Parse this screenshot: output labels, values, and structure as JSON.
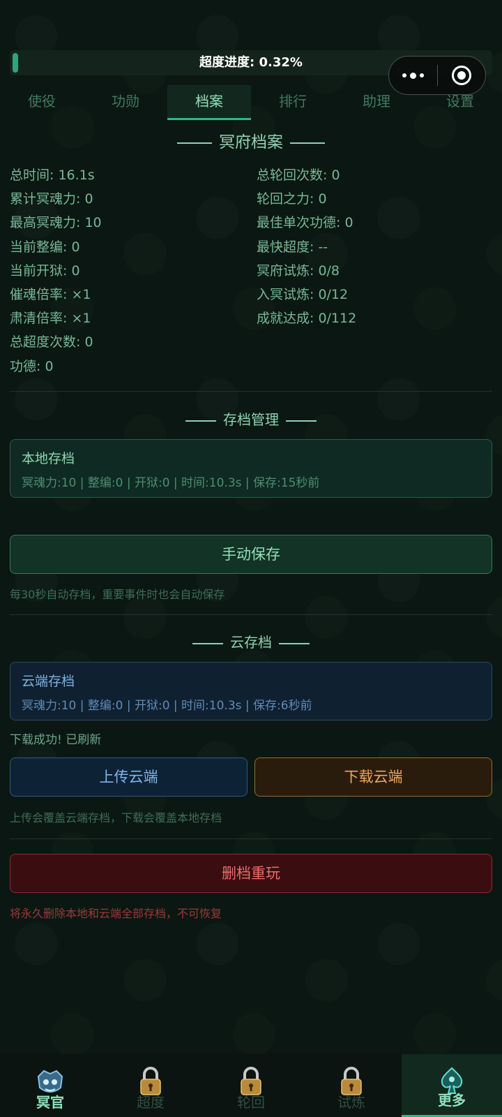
{
  "progress": {
    "label": "超度进度: 0.32%",
    "value": 0.32
  },
  "tabs": [
    "使役",
    "功勋",
    "档案",
    "排行",
    "助理",
    "设置"
  ],
  "active_tab": "档案",
  "archive": {
    "title": "冥府档案",
    "left_stats": [
      "总时间: 16.1s",
      "累计冥魂力: 0",
      "最高冥魂力: 10",
      "当前整编: 0",
      "当前开狱: 0",
      "催魂倍率: ×1",
      "肃清倍率: ×1",
      "总超度次数: 0",
      "功德: 0"
    ],
    "right_stats": [
      "总轮回次数: 0",
      "轮回之力: 0",
      "最佳单次功德: 0",
      "最快超度: --",
      "冥府试炼: 0/8",
      "入冥试炼: 0/12",
      "成就达成: 0/112"
    ]
  },
  "save_mgmt": {
    "title": "存档管理",
    "local_title": "本地存档",
    "local_info": "冥魂力:10 | 整编:0 | 开狱:0 | 时间:10.3s | 保存:15秒前",
    "save_button": "手动保存",
    "auto_hint": "每30秒自动存档，重要事件时也会自动保存"
  },
  "cloud": {
    "title": "云存档",
    "card_title": "云端存档",
    "card_info": "冥魂力:10 | 整编:0 | 开狱:0 | 时间:10.3s | 保存:6秒前",
    "status": "下载成功! 已刷新",
    "upload_button": "上传云端",
    "download_button": "下载云端",
    "hint": "上传会覆盖云端存档，下载会覆盖本地存档"
  },
  "danger": {
    "delete_button": "删档重玩",
    "hint": "将永久删除本地和云端全部存档，不可恢复"
  },
  "bottom_nav": [
    {
      "label": "冥官",
      "icon": "ghost-mask-icon",
      "locked": false
    },
    {
      "label": "超度",
      "icon": "lock-icon",
      "locked": true
    },
    {
      "label": "轮回",
      "icon": "lock-icon",
      "locked": true
    },
    {
      "label": "试炼",
      "icon": "lock-icon",
      "locked": true
    },
    {
      "label": "更多",
      "icon": "spade-emblem-icon",
      "locked": false,
      "active": true
    }
  ],
  "colors": {
    "accent": "#33b585",
    "background": "#0b1712",
    "danger": "#ef6b6b",
    "cloud": "#7fb5e8",
    "warm": "#e8a866"
  }
}
